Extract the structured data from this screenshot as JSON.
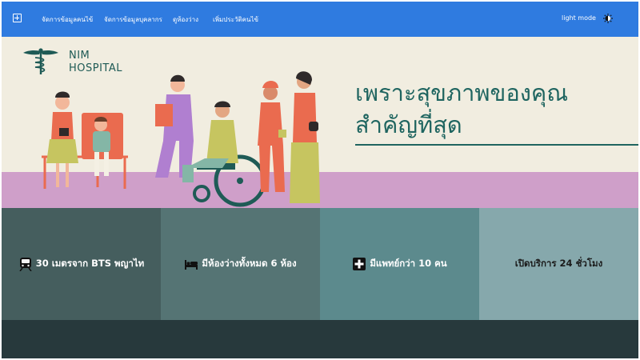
{
  "navbar": {
    "brand_icon": "plus-square-icon",
    "links": [
      {
        "label": "จัดการข้อมูลคนไข้"
      },
      {
        "label": "จัดการข้อมูลบุคลากร"
      },
      {
        "label": "ดูห้องว่าง"
      },
      {
        "label": "เพิ่มประวัติคนไข้"
      }
    ],
    "mode_label": "light mode",
    "mode_icon": "theme-toggle-icon"
  },
  "hero": {
    "logo_line1": "NIM",
    "logo_line2": "HOSPITAL",
    "headline_line1": "เพราะสุขภาพของคุณ",
    "headline_line2": "สำคัญที่สุด",
    "background": "#f1ede0",
    "band_color": "#cf9fc9"
  },
  "features": [
    {
      "icon": "train-icon",
      "text": "30 เมตรจาก BTS พญาไท",
      "color": "#455e5e"
    },
    {
      "icon": "bed-icon",
      "text": "มีห้องว่างทั้งหมด 6 ห้อง",
      "color": "#557474"
    },
    {
      "icon": "medical-cross-icon",
      "text": "มีแพทย์กว่า 10 คน",
      "color": "#5c8a8d"
    },
    {
      "icon": "",
      "text": "เปิดบริการ 24 ชั่วโมง",
      "color": "#86a8ac"
    }
  ],
  "colors": {
    "navbar": "#2f7be0",
    "accent_teal": "#1f6560",
    "footer": "#27393c"
  }
}
